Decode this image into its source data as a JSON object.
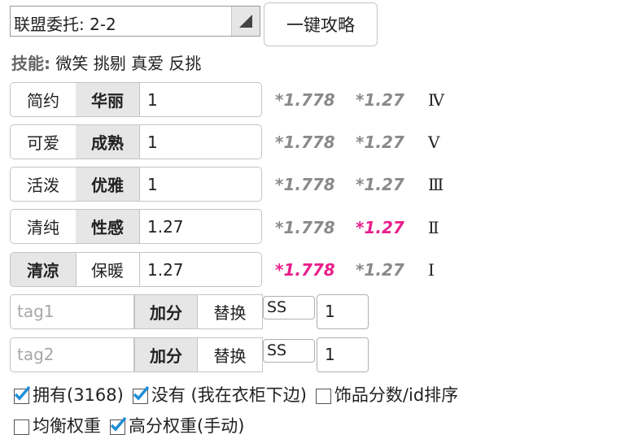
{
  "header": {
    "task_select_value": "联盟委托: 2-2",
    "one_key_label": "一键攻略",
    "skills_label": "技能:",
    "skills_value": "微笑 挑剔 真爱 反挑"
  },
  "style_rows": [
    {
      "left": "简约",
      "right": "华丽",
      "active": "right",
      "value": "1",
      "m1": "*1.778",
      "m2": "*1.27",
      "m1_highlight": false,
      "m2_highlight": false,
      "rank": "Ⅳ"
    },
    {
      "left": "可爱",
      "right": "成熟",
      "active": "right",
      "value": "1",
      "m1": "*1.778",
      "m2": "*1.27",
      "m1_highlight": false,
      "m2_highlight": false,
      "rank": "Ⅴ"
    },
    {
      "left": "活泼",
      "right": "优雅",
      "active": "right",
      "value": "1",
      "m1": "*1.778",
      "m2": "*1.27",
      "m1_highlight": false,
      "m2_highlight": false,
      "rank": "Ⅲ"
    },
    {
      "left": "清纯",
      "right": "性感",
      "active": "right",
      "value": "1.27",
      "m1": "*1.778",
      "m2": "*1.27",
      "m1_highlight": false,
      "m2_highlight": true,
      "rank": "Ⅱ"
    },
    {
      "left": "清凉",
      "right": "保暖",
      "active": "left",
      "value": "1.27",
      "m1": "*1.778",
      "m2": "*1.27",
      "m1_highlight": true,
      "m2_highlight": false,
      "rank": "Ⅰ"
    }
  ],
  "tag_rows": [
    {
      "placeholder": "tag1",
      "add_label": "加分",
      "replace_label": "替换",
      "grade": "SS",
      "count": "1"
    },
    {
      "placeholder": "tag2",
      "add_label": "加分",
      "replace_label": "替换",
      "grade": "SS",
      "count": "1"
    }
  ],
  "checkboxes": [
    {
      "label": "拥有(3168)",
      "checked": true
    },
    {
      "label": "没有 (我在衣柜下边)",
      "checked": true
    },
    {
      "label": "饰品分数/id排序",
      "checked": false
    },
    {
      "label": "均衡权重",
      "checked": false
    },
    {
      "label": "高分权重(手动)",
      "checked": true
    }
  ],
  "colors": {
    "highlight": "#e8208c",
    "muted": "#8a8a8a",
    "check": "#1f8ed6",
    "active_bg": "#e6e6e6"
  }
}
